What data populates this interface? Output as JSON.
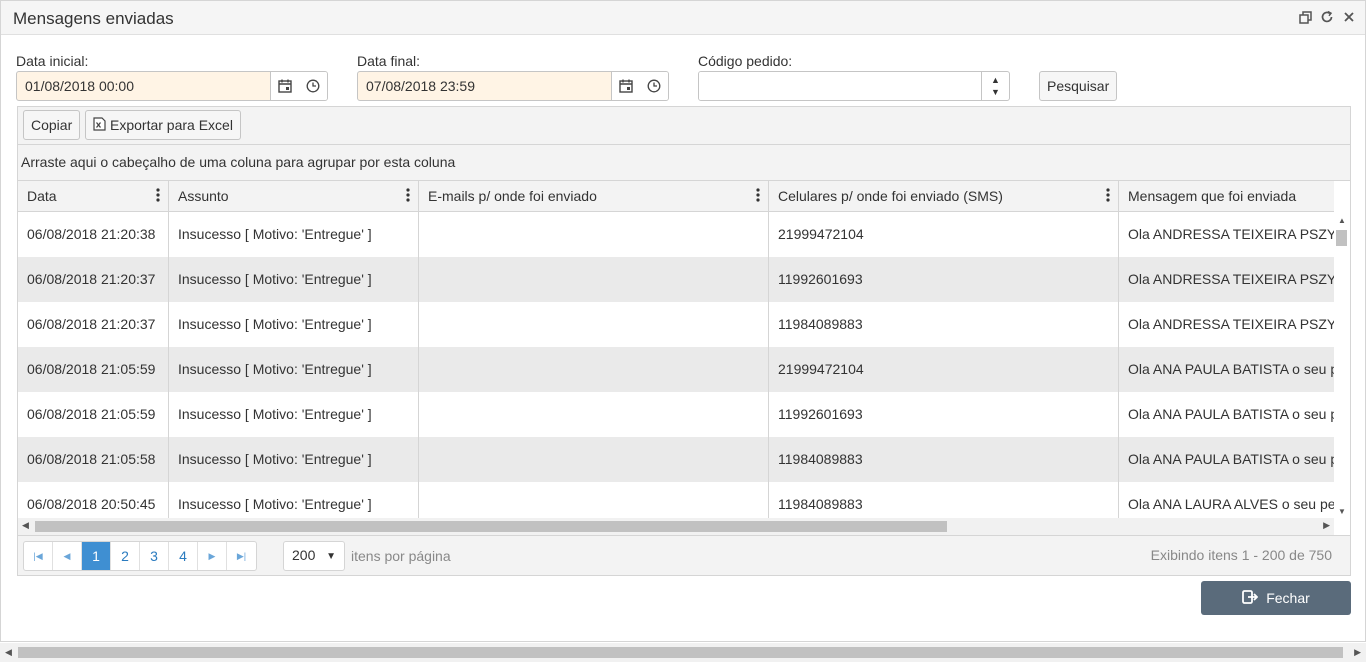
{
  "window": {
    "title": "Mensagens enviadas"
  },
  "filters": {
    "start_label": "Data inicial:",
    "start_value": "01/08/2018 00:00",
    "end_label": "Data final:",
    "end_value": "07/08/2018 23:59",
    "order_label": "Código pedido:",
    "order_value": "",
    "search_label": "Pesquisar"
  },
  "toolbar": {
    "copy_label": "Copiar",
    "export_label": "Exportar para Excel"
  },
  "grid": {
    "group_hint": "Arraste aqui o cabeçalho de uma coluna para agrupar por esta coluna",
    "columns": [
      "Data",
      "Assunto",
      "E-mails p/ onde foi enviado",
      "Celulares p/ onde foi enviado (SMS)",
      "Mensagem que foi enviada"
    ],
    "rows": [
      [
        "06/08/2018 21:20:38",
        "Insucesso [ Motivo: 'Entregue' ]",
        "",
        "21999472104",
        "Ola ANDRESSA TEIXEIRA PSZY"
      ],
      [
        "06/08/2018 21:20:37",
        "Insucesso [ Motivo: 'Entregue' ]",
        "",
        "11992601693",
        "Ola ANDRESSA TEIXEIRA PSZY"
      ],
      [
        "06/08/2018 21:20:37",
        "Insucesso [ Motivo: 'Entregue' ]",
        "",
        "11984089883",
        "Ola ANDRESSA TEIXEIRA PSZY"
      ],
      [
        "06/08/2018 21:05:59",
        "Insucesso [ Motivo: 'Entregue' ]",
        "",
        "21999472104",
        "Ola ANA PAULA BATISTA o seu p"
      ],
      [
        "06/08/2018 21:05:59",
        "Insucesso [ Motivo: 'Entregue' ]",
        "",
        "11992601693",
        "Ola ANA PAULA BATISTA o seu p"
      ],
      [
        "06/08/2018 21:05:58",
        "Insucesso [ Motivo: 'Entregue' ]",
        "",
        "11984089883",
        "Ola ANA PAULA BATISTA o seu p"
      ],
      [
        "06/08/2018 20:50:45",
        "Insucesso [ Motivo: 'Entregue' ]",
        "",
        "11984089883",
        "Ola ANA LAURA ALVES o seu pe"
      ]
    ]
  },
  "pager": {
    "pages": [
      "1",
      "2",
      "3",
      "4"
    ],
    "current_page": "1",
    "page_size": "200",
    "page_size_label": "itens por página",
    "info": "Exibindo itens 1 - 200 de 750"
  },
  "footer": {
    "close_label": "Fechar"
  },
  "colors": {
    "date_field_bg": "#fff4e5",
    "active_page": "#3f8fd2",
    "close_button": "#5a6b7b"
  }
}
